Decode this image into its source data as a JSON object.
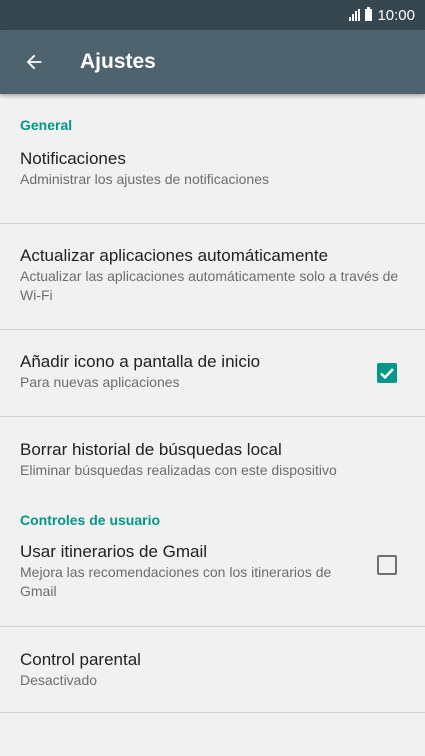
{
  "status_bar": {
    "time": "10:00"
  },
  "toolbar": {
    "title": "Ajustes",
    "back_icon": "arrow-back-icon"
  },
  "sections": {
    "general": {
      "header": "General",
      "notifications": {
        "title": "Notificaciones",
        "subtitle": "Administrar los ajustes de notificaciones"
      },
      "auto_update": {
        "title": "Actualizar aplicaciones automáticamente",
        "subtitle": "Actualizar las aplicaciones automáticamente solo a través de Wi-Fi"
      },
      "add_icon": {
        "title": "Añadir icono a pantalla de inicio",
        "subtitle": "Para nuevas aplicaciones",
        "checked": true
      },
      "clear_history": {
        "title": "Borrar historial de búsquedas  local",
        "subtitle": "Eliminar búsquedas realizadas con este dispositivo"
      }
    },
    "user_controls": {
      "header": "Controles de usuario",
      "gmail_trips": {
        "title": "Usar itinerarios de Gmail",
        "subtitle": "Mejora las recomendaciones con los itinerarios de Gmail",
        "checked": false
      },
      "parental": {
        "title": "Control parental",
        "subtitle": "Desactivado"
      }
    }
  },
  "colors": {
    "status_bar": "#37474f",
    "toolbar": "#4f636e",
    "accent": "#009688",
    "background": "#f1f1f1"
  }
}
